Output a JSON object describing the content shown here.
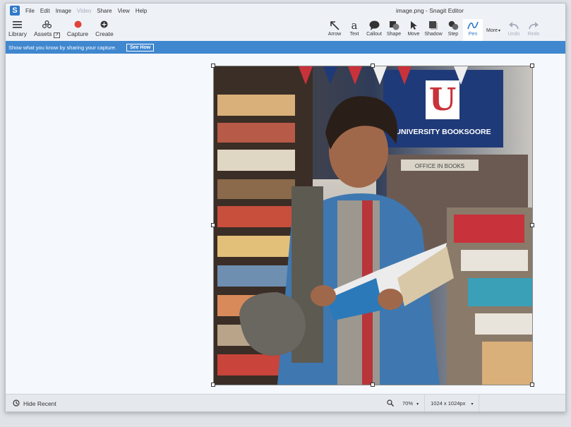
{
  "app": {
    "icon": "S",
    "title": "image.png - Snagit Editor"
  },
  "menu": [
    {
      "label": "File",
      "disabled": false
    },
    {
      "label": "Edit",
      "disabled": false
    },
    {
      "label": "Image",
      "disabled": false
    },
    {
      "label": "Video",
      "disabled": true
    },
    {
      "label": "Share",
      "disabled": false
    },
    {
      "label": "View",
      "disabled": false
    },
    {
      "label": "Help",
      "disabled": false
    }
  ],
  "left_toolbar": {
    "library": "Library",
    "assets": "Assets",
    "capture": "Capture",
    "create": "Create"
  },
  "tools": {
    "arrow": "Arrow",
    "text": "Text",
    "callout": "Callout",
    "shape": "Shape",
    "move": "Move",
    "shadow": "Shadow",
    "step": "Step",
    "pen": "Pen",
    "more": "More",
    "undo": "Undo",
    "redo": "Redo"
  },
  "banner": {
    "text": "Show what you know by sharing your capture.",
    "button": "See How"
  },
  "image_content": {
    "sign": "UNIVERSITY BOOKSOORE",
    "shelf_label": "OFFICE IN BOOKS"
  },
  "status": {
    "hide_recent": "Hide Recent",
    "zoom": "70%",
    "dimensions": "1024 x 1024px"
  },
  "colors": {
    "accent": "#3f87cf",
    "active_tool": "#2a78c8",
    "record": "#e0433a"
  }
}
